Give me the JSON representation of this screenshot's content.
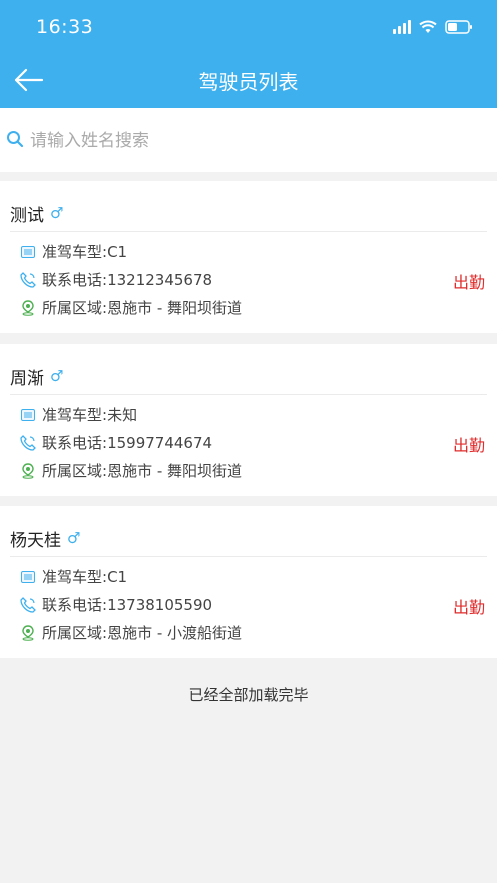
{
  "status_bar": {
    "time": "16:33"
  },
  "nav": {
    "title": "驾驶员列表"
  },
  "search": {
    "placeholder": "请输入姓名搜索"
  },
  "labels": {
    "license": "准驾车型: ",
    "phone": "联系电话: ",
    "area": "所属区域: "
  },
  "drivers": [
    {
      "name": "测试",
      "gender_icon": "male-icon",
      "license_type": "C1",
      "phone": "13212345678",
      "area": "恩施市 - 舞阳坝街道",
      "status": "出勤"
    },
    {
      "name": "周渐",
      "gender_icon": "male-icon",
      "license_type": "未知",
      "phone": "15997744674",
      "area": "恩施市 - 舞阳坝街道",
      "status": "出勤"
    },
    {
      "name": "杨天桂",
      "gender_icon": "male-icon",
      "license_type": "C1",
      "phone": "13738105590",
      "area": "恩施市 - 小渡船街道",
      "status": "出勤"
    }
  ],
  "footer": {
    "load_complete": "已经全部加载完毕"
  },
  "colors": {
    "header": "#3fb0ee",
    "status_active": "#e02c2c",
    "male_icon": "#3fb0ee"
  }
}
